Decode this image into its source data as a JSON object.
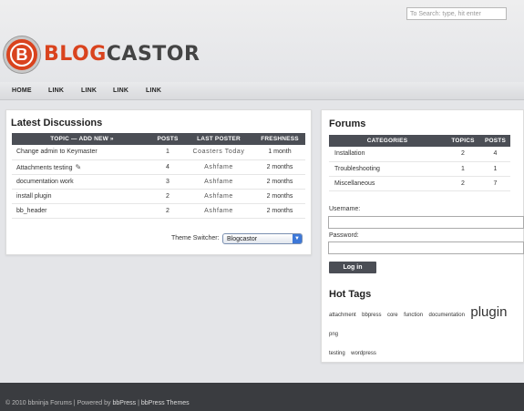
{
  "search": {
    "placeholder": "To Search: type, hit enter"
  },
  "logo": {
    "letter": "B",
    "part1": "BLOG",
    "part2": "CASTOR"
  },
  "nav": [
    "HOME",
    "LINK",
    "LINK",
    "LINK",
    "LINK"
  ],
  "discussions": {
    "title": "Latest Discussions",
    "headers": [
      "TOPIC — ADD NEW »",
      "POSTS",
      "LAST POSTER",
      "FRESHNESS"
    ],
    "rows": [
      {
        "topic": "Change admin to Keymaster",
        "posts": "1",
        "poster": "Coasters Today",
        "freshness": "1 month",
        "edit": false
      },
      {
        "topic": "Attachments testing",
        "posts": "4",
        "poster": "Ashfame",
        "freshness": "2 months",
        "edit": true
      },
      {
        "topic": "documentation work",
        "posts": "3",
        "poster": "Ashfame",
        "freshness": "2 months",
        "edit": false
      },
      {
        "topic": "install plugin",
        "posts": "2",
        "poster": "Ashfame",
        "freshness": "2 months",
        "edit": false
      },
      {
        "topic": "bb_header",
        "posts": "2",
        "poster": "Ashfame",
        "freshness": "2 months",
        "edit": false
      }
    ],
    "theme_label": "Theme Switcher:",
    "theme_value": "Blogcastor"
  },
  "forums": {
    "title": "Forums",
    "headers": [
      "CATEGORIES",
      "TOPICS",
      "POSTS"
    ],
    "rows": [
      {
        "name": "Installation",
        "topics": "2",
        "posts": "4"
      },
      {
        "name": "Troubleshooting",
        "topics": "1",
        "posts": "1"
      },
      {
        "name": "Miscellaneous",
        "topics": "2",
        "posts": "7"
      }
    ]
  },
  "login": {
    "username_label": "Username:",
    "password_label": "Password:",
    "button": "Log in"
  },
  "hot_tags": {
    "title": "Hot Tags",
    "tags": [
      "attachment",
      "bbpress",
      "core",
      "function",
      "documentation",
      "plugin",
      "png",
      "testing",
      "wordpress"
    ]
  },
  "footer": {
    "prefix": "© 2010 bbninja Forums | Powered by ",
    "link1": "bbPress",
    "sep": " | ",
    "link2": "bbPress Themes"
  }
}
